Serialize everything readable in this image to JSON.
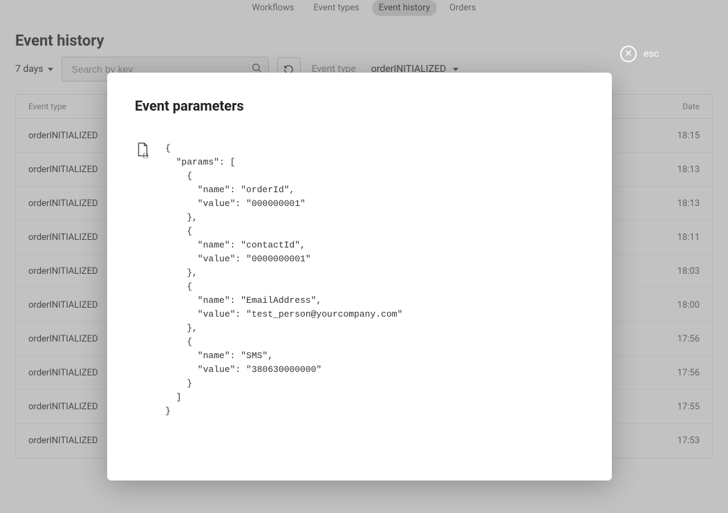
{
  "nav": {
    "items": [
      {
        "label": "Workflows",
        "active": false
      },
      {
        "label": "Event types",
        "active": false
      },
      {
        "label": "Event history",
        "active": true
      },
      {
        "label": "Orders",
        "active": false
      }
    ]
  },
  "page": {
    "title": "Event history"
  },
  "toolbar": {
    "range": "7 days",
    "search_placeholder": "Search by key",
    "filter_label": "Event type",
    "filter_value": "orderINITIALIZED"
  },
  "table": {
    "headers": {
      "type": "Event type",
      "date": "Date"
    },
    "rows": [
      {
        "type": "orderINITIALIZED",
        "date": "18:15"
      },
      {
        "type": "orderINITIALIZED",
        "date": "18:13"
      },
      {
        "type": "orderINITIALIZED",
        "date": "18:13"
      },
      {
        "type": "orderINITIALIZED",
        "date": "18:11"
      },
      {
        "type": "orderINITIALIZED",
        "date": "18:03"
      },
      {
        "type": "orderINITIALIZED",
        "date": "18:00"
      },
      {
        "type": "orderINITIALIZED",
        "date": "17:56"
      },
      {
        "type": "orderINITIALIZED",
        "date": "17:56"
      },
      {
        "type": "orderINITIALIZED",
        "date": "17:55"
      },
      {
        "type": "orderINITIALIZED",
        "date": "17:53"
      }
    ]
  },
  "modal": {
    "title": "Event parameters",
    "esc_label": "esc",
    "json_text": "{\n  \"params\": [\n    {\n      \"name\": \"orderId\",\n      \"value\": \"000000001\"\n    },\n    {\n      \"name\": \"contactId\",\n      \"value\": \"0000000001\"\n    },\n    {\n      \"name\": \"EmailAddress\",\n      \"value\": \"test_person@yourcompany.com\"\n    },\n    {\n      \"name\": \"SMS\",\n      \"value\": \"380630000000\"\n    }\n  ]\n}"
  }
}
